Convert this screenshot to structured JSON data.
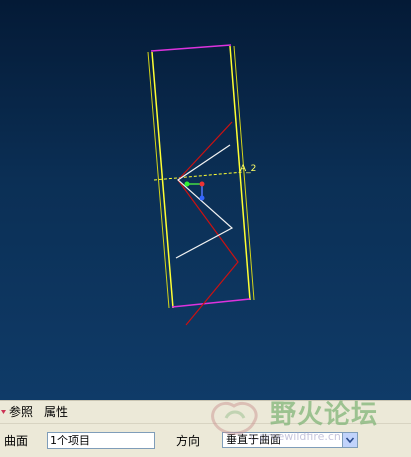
{
  "viewport": {
    "datum_axis_label": "A_2",
    "colors": {
      "background_top": "#041a36",
      "background_bottom": "#0f3b68",
      "edges_yellow": "#ffff33",
      "edges_magenta": "#dd33dd",
      "curve_red": "#cc1111",
      "curve_white": "#f2f2f2"
    },
    "csys_icon": "coordinate-system-icon"
  },
  "panel": {
    "tabs": {
      "references": "参照",
      "properties": "属性"
    },
    "surface_label": "曲面",
    "surface_value": "1个项目",
    "direction_label": "方向",
    "direction_value": "垂直于曲面"
  },
  "watermark": {
    "text": "野火论坛",
    "url": "c.proewildfire.cn"
  }
}
